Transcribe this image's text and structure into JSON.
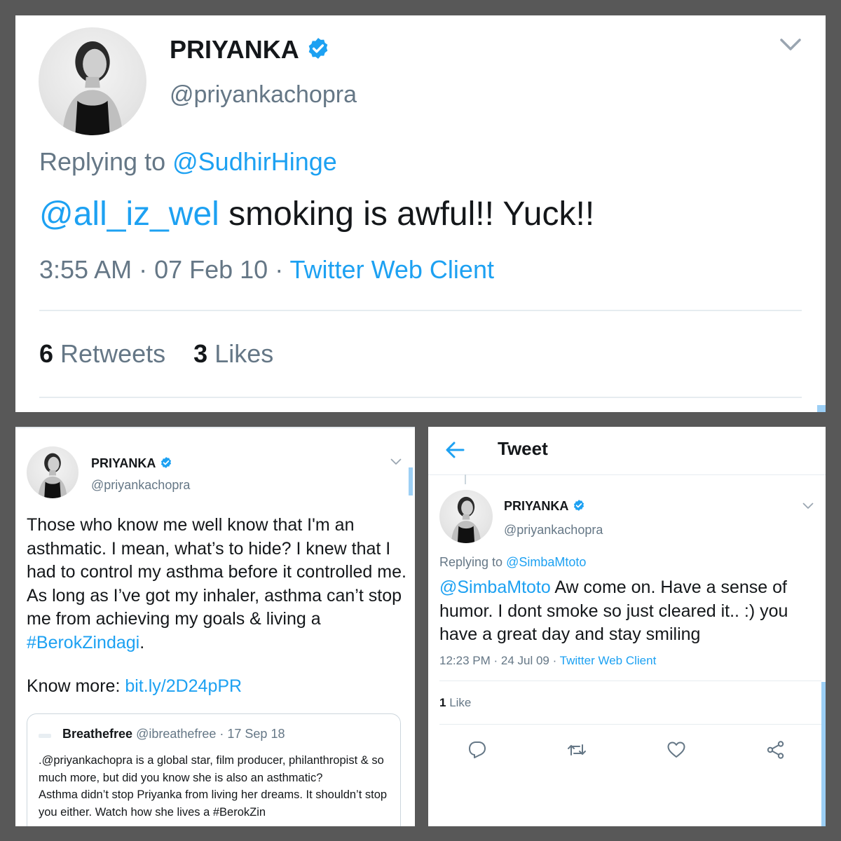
{
  "colors": {
    "background": "#585858",
    "link": "#1da1f2",
    "muted": "#657786",
    "text": "#14171a"
  },
  "panel1": {
    "name": "PRIYANKA",
    "handle": "@priyankachopra",
    "replying_prefix": "Replying to",
    "replying_to": "@SudhirHinge",
    "mention": "@all_iz_wel",
    "text": " smoking is awful!! Yuck!!",
    "time": "3:55 AM · 07 Feb 10 · ",
    "source": "Twitter Web Client",
    "retweets_count": "6",
    "retweets_label": "Retweets",
    "likes_count": "3",
    "likes_label": "Likes"
  },
  "panel2": {
    "name": "PRIYANKA",
    "handle": "@priyankachopra",
    "text_body": "Those who know me well know that I'm an asthmatic. I mean, what’s to hide? I knew that I had to control my asthma before it controlled me. As long as I’ve got my inhaler, asthma can’t stop me from achieving my goals & living a ",
    "hashtag": "#BerokZindagi",
    "text_end": ".",
    "more_prefix": "Know more: ",
    "more_link": "bit.ly/2D24pPR",
    "quote": {
      "name": "Breathefree",
      "handle_date": "@ibreathefree · 17 Sep 18",
      "text": ".@priyankachopra is a global star, film producer, philanthropist & so much more, but did you know she is also an asthmatic?",
      "text2": "Asthma didn’t stop Priyanka from living her dreams. It shouldn’t stop you either. Watch how she lives a #BerokZin"
    }
  },
  "panel3": {
    "header_title": "Tweet",
    "name": "PRIYANKA",
    "handle": "@priyankachopra",
    "replying_prefix": "Replying to",
    "replying_to": "@SimbaMtoto",
    "mention": "@SimbaMtoto",
    "text": " Aw come on. Have a sense of humor. I dont smoke so just cleared it.. :) you have a great day and stay smiling",
    "time": "12:23 PM · 24 Jul 09 · ",
    "source": "Twitter Web Client",
    "likes_count": "1",
    "likes_label": "Like",
    "actions": [
      "reply-icon",
      "retweet-icon",
      "like-icon",
      "share-icon"
    ]
  }
}
